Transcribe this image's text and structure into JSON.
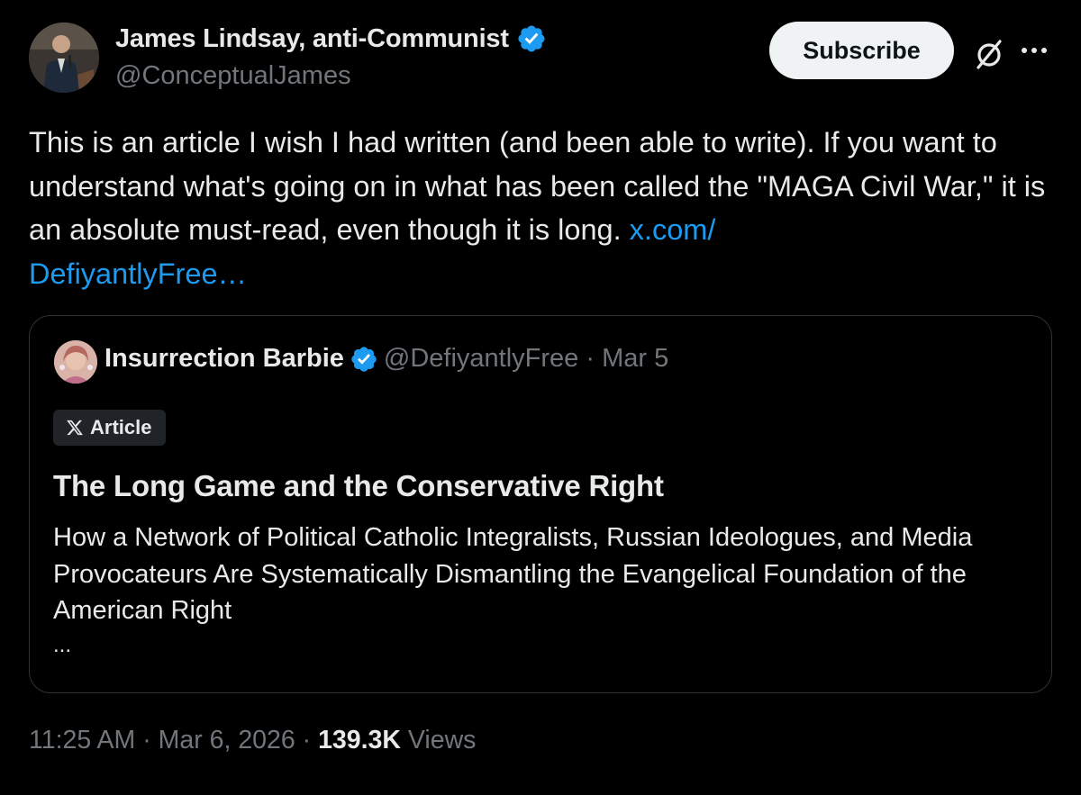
{
  "author": {
    "display_name": "James Lindsay, anti-Communist",
    "handle": "@ConceptualJames",
    "verified": true
  },
  "header_actions": {
    "subscribe_label": "Subscribe",
    "grok_icon": "grok-icon",
    "more_icon": "more-icon"
  },
  "tweet": {
    "text": "This is an article I wish I had written (and been able to write). If you want to understand what's going on in what has been called the \"MAGA Civil War,\" it is an absolute must-read, even though it is long. ",
    "link_part1": "x.com/",
    "link_part2": "DefiyantlyFree…"
  },
  "quote": {
    "display_name": "Insurrection Barbie",
    "handle": "@DefiyantlyFree",
    "separator": " · ",
    "date": "Mar 5",
    "badge_label": "Article",
    "title": "The Long Game and the Conservative Right",
    "subtitle": "How a Network of Political Catholic Integralists, Russian Ideologues, and Media Provocateurs Are Systematically Dismantling the Evangelical Foundation of the American Right",
    "ellipsis": "..."
  },
  "footer": {
    "time": "11:25 AM",
    "sep": " · ",
    "date": "Mar 6, 2026",
    "views_count": "139.3K",
    "views_label": " Views"
  },
  "colors": {
    "background": "#000000",
    "text": "#e7e9ea",
    "muted": "#71767b",
    "link": "#1d9bf0",
    "verified": "#1d9bf0",
    "border": "#2f3336"
  }
}
